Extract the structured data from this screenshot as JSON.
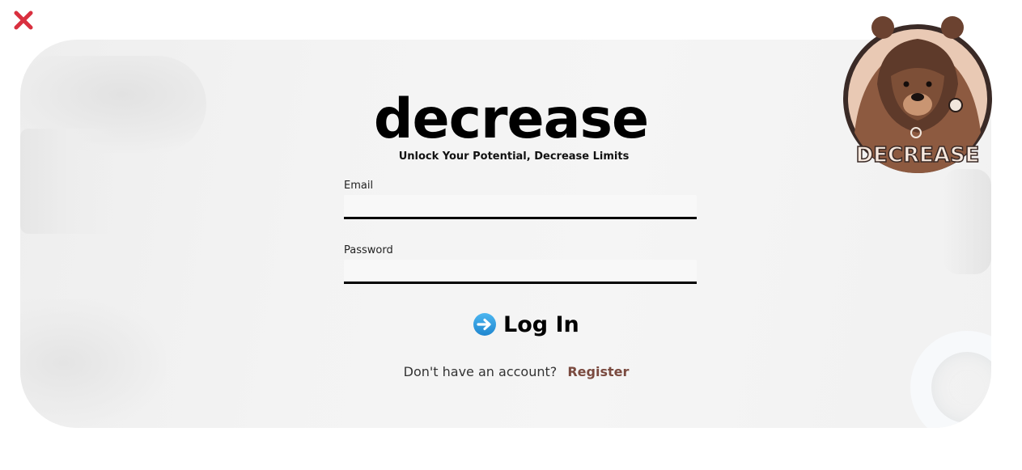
{
  "brand": {
    "title": "decrease",
    "tagline": "Unlock Your Potential, Decrease Limits",
    "logo_text": "DECREASE"
  },
  "form": {
    "email_label": "Email",
    "email_value": "",
    "password_label": "Password",
    "password_value": "",
    "login_label": "Log In",
    "login_icon": "right-arrow-icon"
  },
  "footer": {
    "prompt": "Don't have an account?",
    "register_label": "Register"
  },
  "icons": {
    "close": "close-icon",
    "logo": "bear-logo"
  },
  "colors": {
    "close_red": "#d9303f",
    "register_brown": "#7a4a3f",
    "login_icon_blue": "#2a9de0"
  }
}
